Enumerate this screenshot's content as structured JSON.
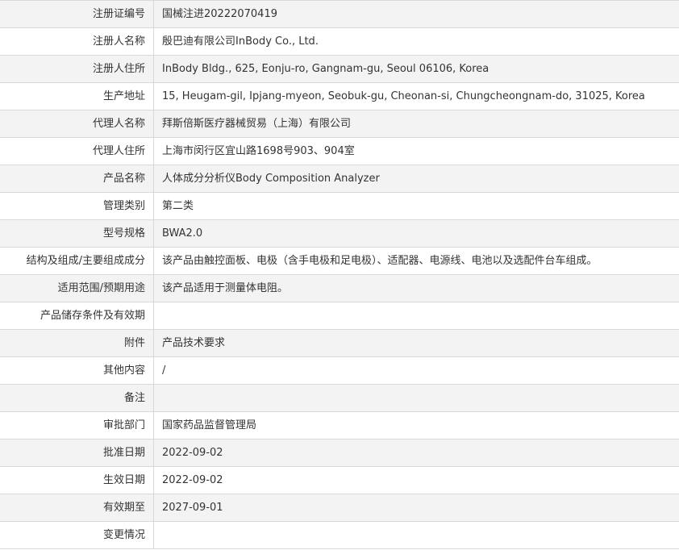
{
  "record": {
    "rows": [
      {
        "label": "注册证编号",
        "value": "国械注进20222070419"
      },
      {
        "label": "注册人名称",
        "value": "殷巴迪有限公司InBody Co., Ltd."
      },
      {
        "label": "注册人住所",
        "value": "InBody Bldg., 625, Eonju-ro, Gangnam-gu, Seoul 06106, Korea"
      },
      {
        "label": "生产地址",
        "value": "15, Heugam-gil, Ipjang-myeon, Seobuk-gu, Cheonan-si, Chungcheongnam-do, 31025, Korea"
      },
      {
        "label": "代理人名称",
        "value": "拜斯倍斯医疗器械贸易（上海）有限公司"
      },
      {
        "label": "代理人住所",
        "value": "上海市闵行区宜山路1698号903、904室"
      },
      {
        "label": "产品名称",
        "value": "人体成分分析仪Body Composition Analyzer"
      },
      {
        "label": "管理类别",
        "value": "第二类"
      },
      {
        "label": "型号规格",
        "value": "BWA2.0"
      },
      {
        "label": "结构及组成/主要组成成分",
        "value": "该产品由触控面板、电极（含手电极和足电极）、适配器、电源线、电池以及选配件台车组成。"
      },
      {
        "label": "适用范围/预期用途",
        "value": "该产品适用于测量体电阻。"
      },
      {
        "label": "产品储存条件及有效期",
        "value": ""
      },
      {
        "label": "附件",
        "value": "产品技术要求"
      },
      {
        "label": "其他内容",
        "value": "/"
      },
      {
        "label": "备注",
        "value": ""
      },
      {
        "label": "审批部门",
        "value": "国家药品监督管理局"
      },
      {
        "label": "批准日期",
        "value": "2022-09-02"
      },
      {
        "label": "生效日期",
        "value": "2022-09-02"
      },
      {
        "label": "有效期至",
        "value": "2027-09-01"
      },
      {
        "label": "变更情况",
        "value": ""
      }
    ]
  },
  "colors": {
    "alt_row_background": "#f3f3f3",
    "border": "#d8d8d8",
    "text": "#333333"
  }
}
